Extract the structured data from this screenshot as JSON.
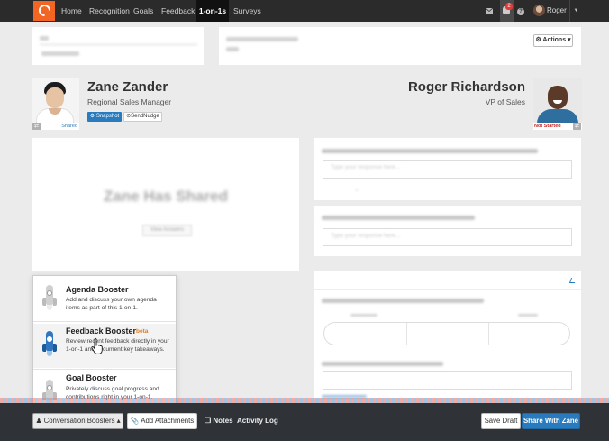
{
  "nav": {
    "items": [
      "Home",
      "Recognition",
      "Goals",
      "Feedback",
      "1-on-1s",
      "Surveys"
    ],
    "active": "1-on-1s",
    "notification_count": "2",
    "user": "Roger",
    "help": "?"
  },
  "header": {
    "actions_label": "⚙ Actions ▾"
  },
  "left_profile": {
    "name": "Zane Zander",
    "role": "Regional Sales Manager",
    "status": "Shared",
    "snapshot_label": "⚙ Snapshot",
    "nudge_label": "⊙SendNudge"
  },
  "right_profile": {
    "name": "Roger Richardson",
    "role": "VP of Sales",
    "status": "Not Started"
  },
  "shared_panel": {
    "title": "Zane Has Shared",
    "button": "View Answers"
  },
  "boosters": [
    {
      "title": "Agenda Booster",
      "badge": "",
      "desc": "Add and discuss your own agenda items as part of this 1-on-1."
    },
    {
      "title": "Feedback Booster",
      "badge": "beta",
      "desc": "Review recent feedback directly in your 1-on-1 and document key takeaways."
    },
    {
      "title": "Goal Booster",
      "badge": "",
      "desc": "Privately discuss goal progress and contributions right in your 1-on-1."
    }
  ],
  "bottom": {
    "boosters_label": "♟ Conversation Boosters ▴",
    "attach_label": "📎 Add Attachments",
    "notes_label": "❐ Notes",
    "activity_label": "Activity Log",
    "save_label": "Save Draft",
    "share_label": "Share With Zane"
  },
  "colors": {
    "brand": "#f26522",
    "primary": "#2a7bbd",
    "beta": "#e07b20",
    "topbar": "#2b2b2b",
    "bottombar": "#2f3338"
  }
}
